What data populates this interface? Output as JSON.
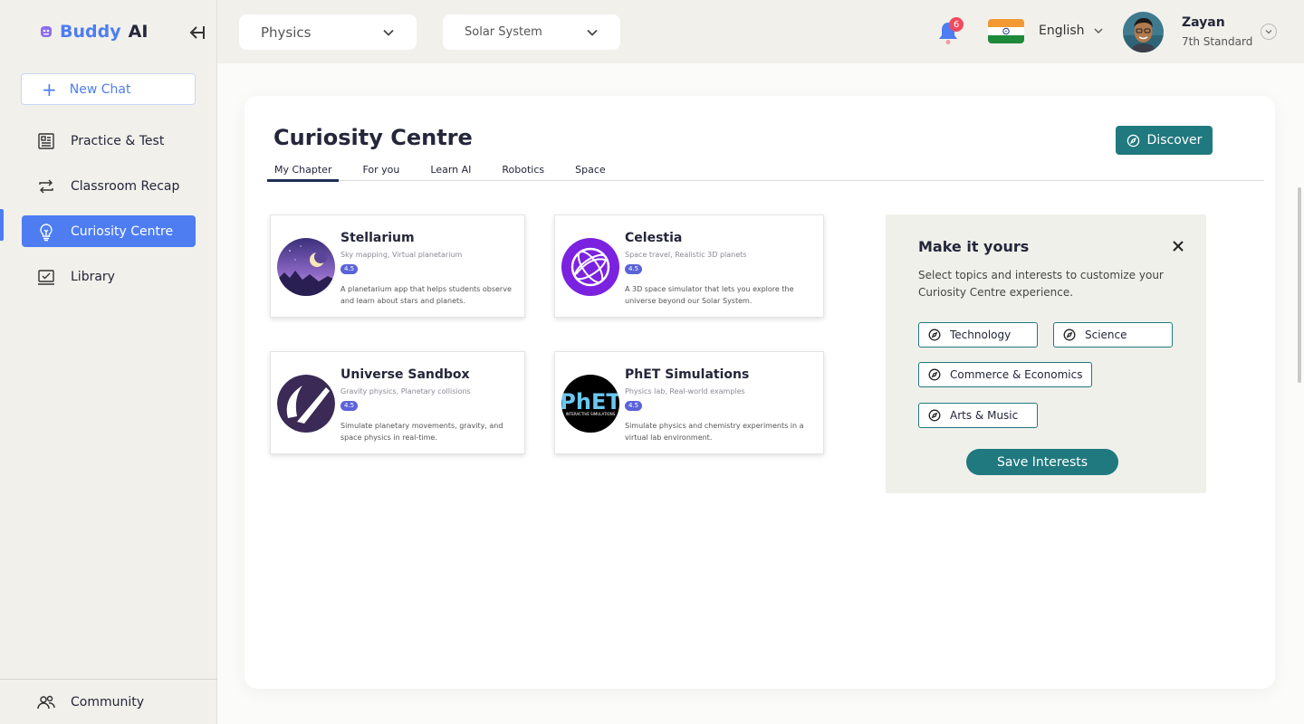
{
  "app": {
    "logo_buddy": "Buddy",
    "logo_ai": "AI"
  },
  "sidebar": {
    "new_chat": "New Chat",
    "items": [
      {
        "label": "Practice & Test",
        "icon": "newspaper-icon"
      },
      {
        "label": "Classroom Recap",
        "icon": "repeat-icon"
      },
      {
        "label": "Curiosity Centre",
        "icon": "lightbulb-icon",
        "active": true
      },
      {
        "label": "Library",
        "icon": "monitor-icon"
      }
    ],
    "footer": {
      "label": "Community",
      "icon": "people-icon"
    }
  },
  "topbar": {
    "subject": "Physics",
    "topic": "Solar System",
    "notification_count": "6",
    "language": "English",
    "user_name": "Zayan",
    "user_grade": "7th Standard"
  },
  "main": {
    "title": "Curiosity Centre",
    "discover_label": "Discover",
    "tabs": [
      "My Chapter",
      "For you",
      "Learn AI",
      "Robotics",
      "Space"
    ],
    "active_tab": 0,
    "cards": [
      {
        "title": "Stellarium",
        "tags": "Sky mapping, Virtual planetarium",
        "rating": "4.5",
        "description": "A planetarium app that helps students observe and learn about stars and planets."
      },
      {
        "title": "Celestia",
        "tags": "Space travel, Realistic 3D planets",
        "rating": "4.5",
        "description": "A 3D space simulator that lets you explore the universe beyond our Solar System."
      },
      {
        "title": "Universe Sandbox",
        "tags": "Gravity physics, Planetary collisions",
        "rating": "4.5",
        "description": "Simulate planetary movements, gravity, and space physics in real-time."
      },
      {
        "title": "PhET Simulations",
        "tags": "Physics lab, Real-world examples",
        "rating": "4.5",
        "description": "Simulate physics and chemistry experiments in a virtual lab environment.",
        "logo_text": "PhET",
        "logo_subtext": "INTERACTIVE SIMULATIONS"
      }
    ]
  },
  "interests": {
    "title": "Make it yours",
    "description": "Select topics and interests to customize your Curiosity Centre experience.",
    "chips": [
      "Technology",
      "Science",
      "Commerce & Economics",
      "Arts & Music"
    ],
    "save_label": "Save Interests"
  },
  "colors": {
    "accent": "#4e7df2",
    "teal": "#20797f",
    "badge": "#ef4b5f",
    "rating": "#5a63d8"
  }
}
